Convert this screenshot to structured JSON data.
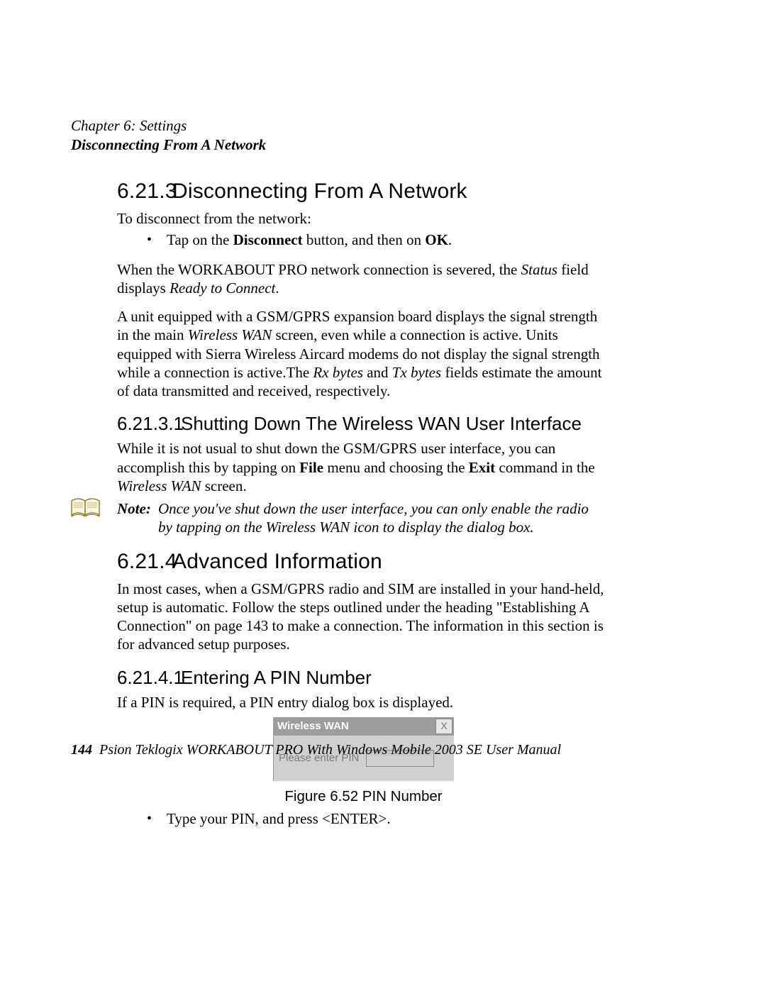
{
  "header": {
    "chapter_line": "Chapter 6: Settings",
    "subtitle": "Disconnecting From A Network"
  },
  "sections": {
    "s6213": {
      "num": "6.21.3",
      "title": "Disconnecting From A Network",
      "intro": "To disconnect from the network:",
      "bullet1_pre": "Tap on the ",
      "bullet1_b1": "Disconnect",
      "bullet1_mid": " button, and then on ",
      "bullet1_b2": "OK",
      "bullet1_post": ".",
      "p2_pre": "When the WORKABOUT PRO network connection is severed, the ",
      "p2_i1": "Status",
      "p2_mid": " field displays ",
      "p2_i2": "Ready to Connect",
      "p2_post": ".",
      "p3_pre": "A unit equipped with a GSM/GPRS expansion board displays the signal strength in the main ",
      "p3_i1": "Wireless WAN",
      "p3_mid1": " screen, even while a connection is active. Units equipped with Sierra Wireless Aircard modems do not display the signal strength while a connection is active.The ",
      "p3_i2": "Rx bytes",
      "p3_and": " and ",
      "p3_i3": "Tx bytes",
      "p3_post": " fields estimate the amount of data transmitted and received, respectively."
    },
    "s62131": {
      "num": "6.21.3.1",
      "title": "Shutting Down The Wireless WAN User Interface",
      "p1_pre": "While it is not usual to shut down the GSM/GPRS user interface, you can accomplish this by tapping on ",
      "p1_b1": "File",
      "p1_mid": " menu and choosing the ",
      "p1_b2": "Exit",
      "p1_mid2": " command in the ",
      "p1_i1": "Wireless WAN",
      "p1_post": " screen.",
      "note_label": "Note:",
      "note_line1": "Once you've shut down the user interface, you can only enable the radio",
      "note_line2": "by tapping on the Wireless WAN icon to display the dialog box."
    },
    "s6214": {
      "num": "6.21.4",
      "title": "Advanced Information",
      "p1": "In most cases, when a GSM/GPRS radio and SIM are installed in your hand-held, setup is automatic. Follow the steps outlined under the heading \"Establishing A Connection\" on page 143 to make a connection. The information in this section is for advanced setup purposes."
    },
    "s62141": {
      "num": "6.21.4.1",
      "title": "Entering A PIN Number",
      "p1": "If a PIN is required, a PIN entry dialog box is displayed.",
      "dialog": {
        "title": "Wireless WAN",
        "close": "X",
        "label": "Please enter PIN"
      },
      "caption": "Figure 6.52 PIN Number",
      "bullet1": "Type your PIN, and press <ENTER>."
    }
  },
  "footer": {
    "page_number": "144",
    "text": "Psion Teklogix WORKABOUT PRO With Windows Mobile 2003 SE User Manual"
  }
}
